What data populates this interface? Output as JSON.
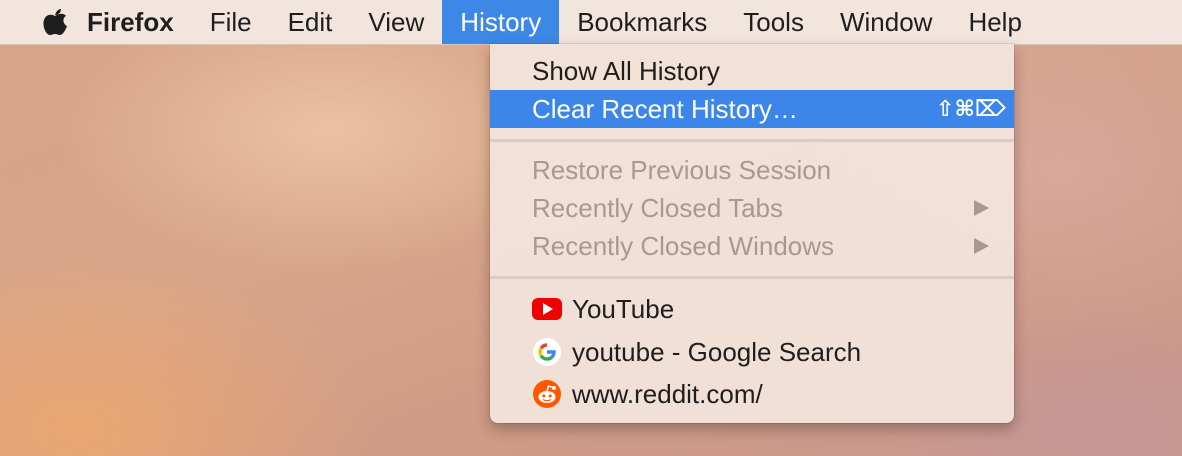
{
  "menubar": {
    "app_name": "Firefox",
    "items": [
      "File",
      "Edit",
      "View",
      "History",
      "Bookmarks",
      "Tools",
      "Window",
      "Help"
    ],
    "active_item": "History"
  },
  "history_menu": {
    "show_all": "Show All History",
    "clear_recent": "Clear Recent History…",
    "clear_recent_shortcut": "⇧⌘⌦",
    "restore_session": "Restore Previous Session",
    "recently_closed_tabs": "Recently Closed Tabs",
    "recently_closed_windows": "Recently Closed Windows",
    "recent": [
      {
        "label": "YouTube",
        "icon": "youtube-icon"
      },
      {
        "label": "youtube - Google Search",
        "icon": "google-icon"
      },
      {
        "label": "www.reddit.com/",
        "icon": "reddit-icon"
      }
    ]
  },
  "colors": {
    "highlight": "#3b86e8",
    "disabled_text": "#a89890"
  }
}
